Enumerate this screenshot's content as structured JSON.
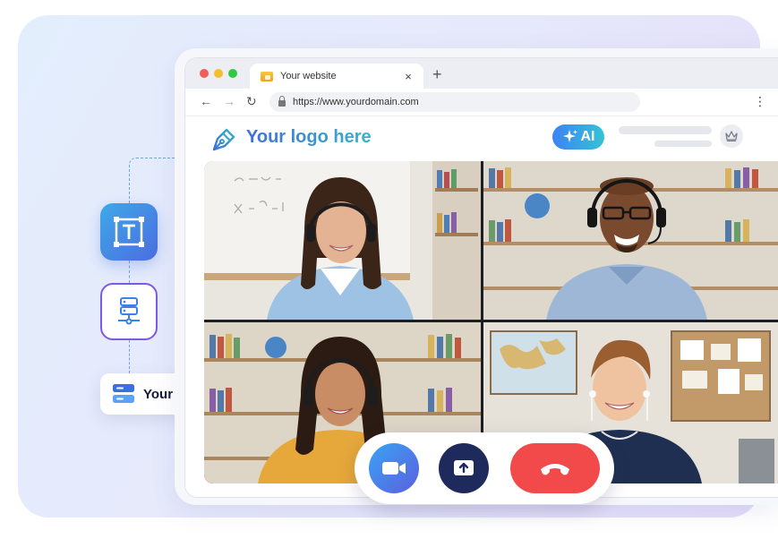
{
  "browser": {
    "tab_title": "Your website",
    "tab_close": "×",
    "new_tab": "+",
    "url": "https://www.yourdomain.com"
  },
  "site": {
    "logo_text": "Your logo here",
    "ai_badge": "AI"
  },
  "side_panel": {
    "host_label": "Your Host"
  },
  "call": {
    "participants": [
      "participant-1",
      "participant-2",
      "participant-3",
      "participant-4"
    ],
    "controls": [
      "camera",
      "share-screen",
      "end-call"
    ]
  },
  "colors": {
    "accent_blue": "#3d82f5",
    "accent_teal": "#34c3d6",
    "end_call_red": "#f24a4a",
    "share_navy": "#1e2a5c",
    "server_purple": "#7d5ae6"
  },
  "icons": [
    "text-tool-icon",
    "server-icon",
    "host-server-icon",
    "pen-logo-icon",
    "sparkle-icon",
    "crown-icon",
    "video-camera-icon",
    "share-screen-icon",
    "end-call-icon",
    "lock-icon"
  ]
}
